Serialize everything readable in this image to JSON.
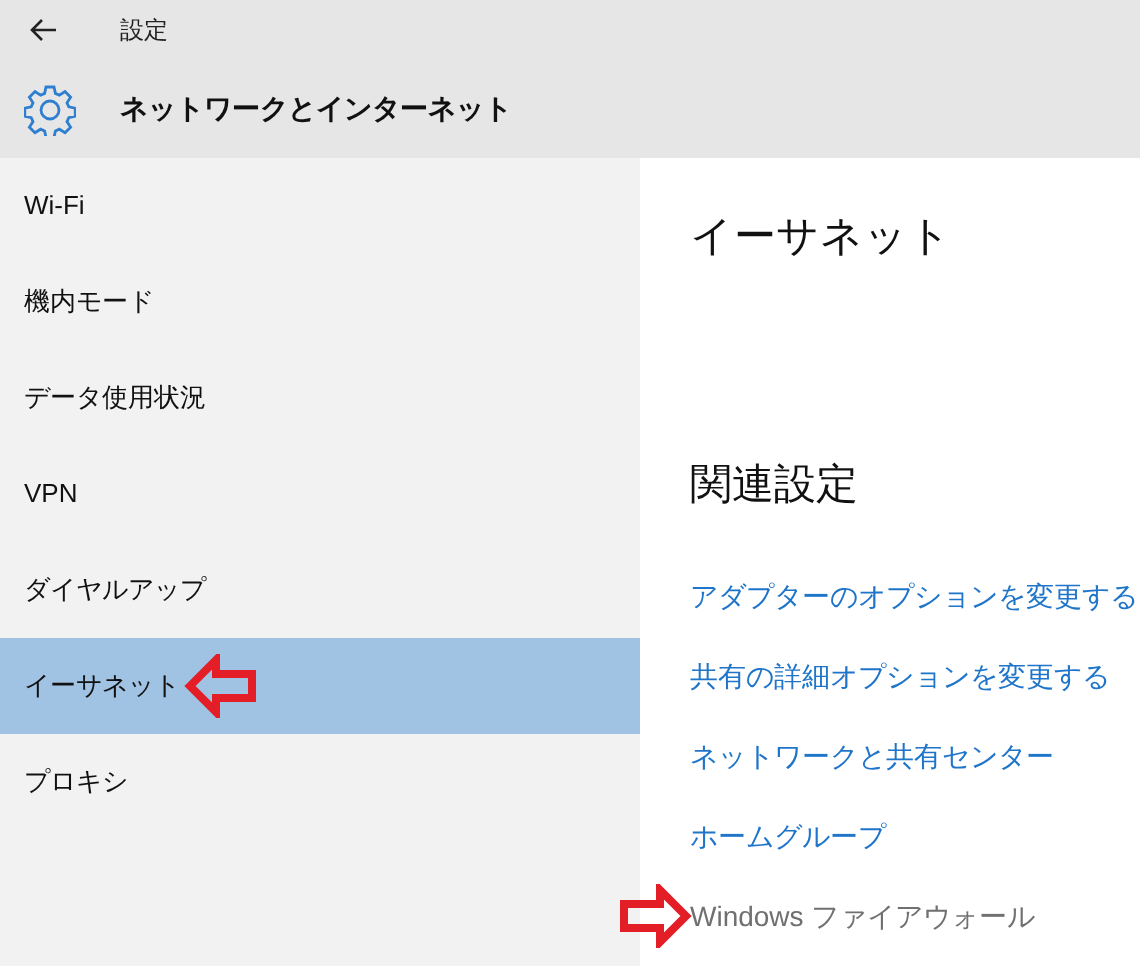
{
  "window": {
    "title": "設定"
  },
  "header": {
    "title": "ネットワークとインターネット"
  },
  "sidebar": {
    "items": [
      {
        "label": "Wi-Fi",
        "selected": false,
        "annotated": false
      },
      {
        "label": "機内モード",
        "selected": false,
        "annotated": false
      },
      {
        "label": "データ使用状況",
        "selected": false,
        "annotated": false
      },
      {
        "label": "VPN",
        "selected": false,
        "annotated": false
      },
      {
        "label": "ダイヤルアップ",
        "selected": false,
        "annotated": false
      },
      {
        "label": "イーサネット",
        "selected": true,
        "annotated": true
      },
      {
        "label": "プロキシ",
        "selected": false,
        "annotated": false
      }
    ]
  },
  "content": {
    "heading": "イーサネット",
    "section_title": "関連設定",
    "links": [
      {
        "label": "アダプターのオプションを変更する",
        "disabled": false,
        "annotated": false
      },
      {
        "label": "共有の詳細オプションを変更する",
        "disabled": false,
        "annotated": false
      },
      {
        "label": "ネットワークと共有センター",
        "disabled": false,
        "annotated": false
      },
      {
        "label": "ホームグループ",
        "disabled": false,
        "annotated": false
      },
      {
        "label": "Windows ファイアウォール",
        "disabled": true,
        "annotated": true
      }
    ]
  }
}
